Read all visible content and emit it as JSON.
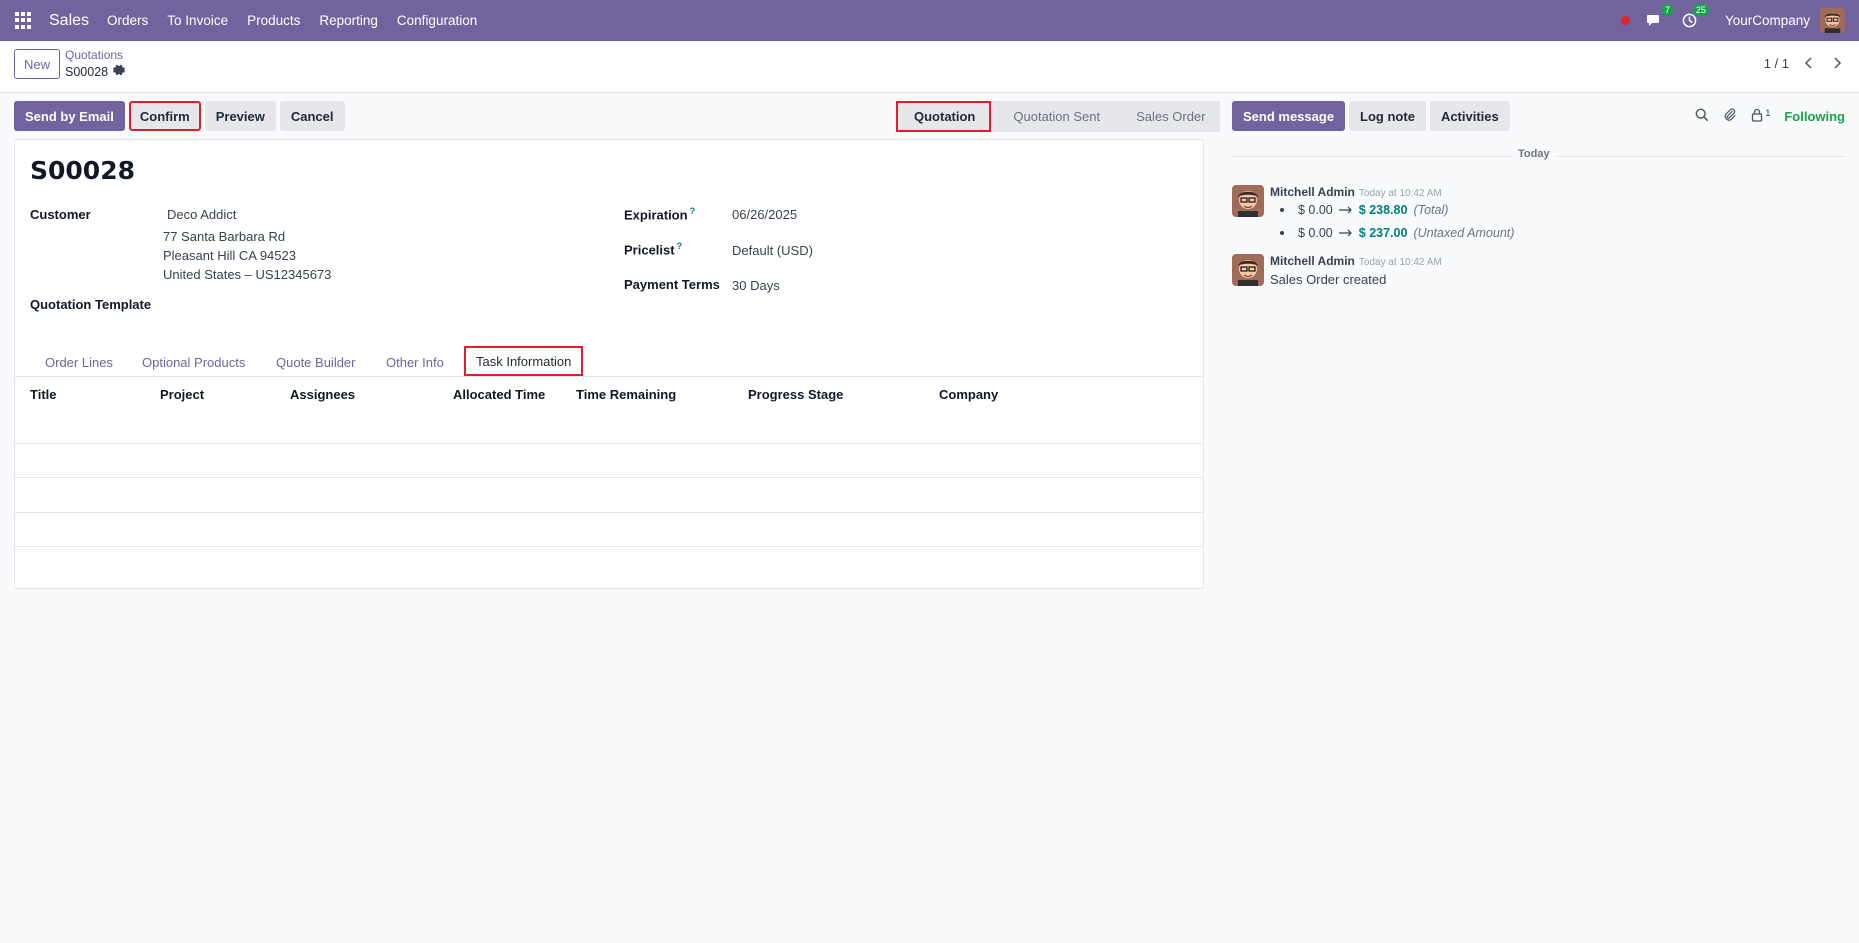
{
  "navbar": {
    "app_name": "Sales",
    "menu": [
      "Orders",
      "To Invoice",
      "Products",
      "Reporting",
      "Configuration"
    ],
    "messages_count": "7",
    "activities_count": "25",
    "company": "YourCompany"
  },
  "control_panel": {
    "new_label": "New",
    "breadcrumb_parent": "Quotations",
    "breadcrumb_current": "S00028",
    "pager": "1 / 1"
  },
  "actions": {
    "send_email": "Send by Email",
    "confirm": "Confirm",
    "preview": "Preview",
    "cancel": "Cancel"
  },
  "statusbar": [
    "Quotation",
    "Quotation Sent",
    "Sales Order"
  ],
  "form": {
    "name": "S00028",
    "customer_label": "Customer",
    "customer_name": "Deco Addict",
    "address_line1": "77 Santa Barbara Rd",
    "address_line2": "Pleasant Hill CA 94523",
    "address_line3": "United States – US12345673",
    "template_label": "Quotation Template",
    "expiration_label": "Expiration",
    "expiration_value": "06/26/2025",
    "pricelist_label": "Pricelist",
    "pricelist_value": "Default (USD)",
    "payment_terms_label": "Payment Terms",
    "payment_terms_value": "30 Days",
    "help_mark": "?"
  },
  "tabs": [
    "Order Lines",
    "Optional Products",
    "Quote Builder",
    "Other Info",
    "Task Information"
  ],
  "task_grid": {
    "columns": [
      "Title",
      "Project",
      "Assignees",
      "Allocated Time",
      "Time Remaining",
      "Progress",
      "Stage",
      "Company"
    ]
  },
  "chatter": {
    "send_message": "Send message",
    "log_note": "Log note",
    "activities": "Activities",
    "followers_count": "1",
    "following": "Following",
    "today": "Today",
    "messages": [
      {
        "author": "Mitchell Admin",
        "time": "Today at 10:42 AM",
        "tracking": [
          {
            "old": "$ 0.00",
            "new": "$ 238.80",
            "field": "(Total)"
          },
          {
            "old": "$ 0.00",
            "new": "$ 237.00",
            "field": "(Untaxed Amount)"
          }
        ]
      },
      {
        "author": "Mitchell Admin",
        "time": "Today at 10:42 AM",
        "body": "Sales Order created"
      }
    ]
  }
}
